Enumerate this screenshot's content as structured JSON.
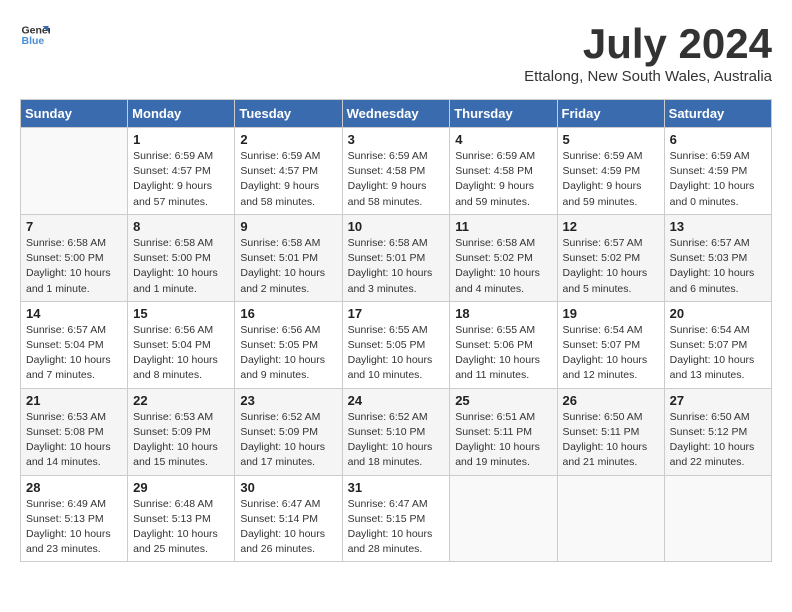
{
  "header": {
    "logo_general": "General",
    "logo_blue": "Blue",
    "month": "July 2024",
    "subtitle": "Ettalong, New South Wales, Australia"
  },
  "calendar": {
    "days_of_week": [
      "Sunday",
      "Monday",
      "Tuesday",
      "Wednesday",
      "Thursday",
      "Friday",
      "Saturday"
    ],
    "weeks": [
      [
        {
          "day": "",
          "info": ""
        },
        {
          "day": "1",
          "info": "Sunrise: 6:59 AM\nSunset: 4:57 PM\nDaylight: 9 hours\nand 57 minutes."
        },
        {
          "day": "2",
          "info": "Sunrise: 6:59 AM\nSunset: 4:57 PM\nDaylight: 9 hours\nand 58 minutes."
        },
        {
          "day": "3",
          "info": "Sunrise: 6:59 AM\nSunset: 4:58 PM\nDaylight: 9 hours\nand 58 minutes."
        },
        {
          "day": "4",
          "info": "Sunrise: 6:59 AM\nSunset: 4:58 PM\nDaylight: 9 hours\nand 59 minutes."
        },
        {
          "day": "5",
          "info": "Sunrise: 6:59 AM\nSunset: 4:59 PM\nDaylight: 9 hours\nand 59 minutes."
        },
        {
          "day": "6",
          "info": "Sunrise: 6:59 AM\nSunset: 4:59 PM\nDaylight: 10 hours\nand 0 minutes."
        }
      ],
      [
        {
          "day": "7",
          "info": "Sunrise: 6:58 AM\nSunset: 5:00 PM\nDaylight: 10 hours\nand 1 minute."
        },
        {
          "day": "8",
          "info": "Sunrise: 6:58 AM\nSunset: 5:00 PM\nDaylight: 10 hours\nand 1 minute."
        },
        {
          "day": "9",
          "info": "Sunrise: 6:58 AM\nSunset: 5:01 PM\nDaylight: 10 hours\nand 2 minutes."
        },
        {
          "day": "10",
          "info": "Sunrise: 6:58 AM\nSunset: 5:01 PM\nDaylight: 10 hours\nand 3 minutes."
        },
        {
          "day": "11",
          "info": "Sunrise: 6:58 AM\nSunset: 5:02 PM\nDaylight: 10 hours\nand 4 minutes."
        },
        {
          "day": "12",
          "info": "Sunrise: 6:57 AM\nSunset: 5:02 PM\nDaylight: 10 hours\nand 5 minutes."
        },
        {
          "day": "13",
          "info": "Sunrise: 6:57 AM\nSunset: 5:03 PM\nDaylight: 10 hours\nand 6 minutes."
        }
      ],
      [
        {
          "day": "14",
          "info": "Sunrise: 6:57 AM\nSunset: 5:04 PM\nDaylight: 10 hours\nand 7 minutes."
        },
        {
          "day": "15",
          "info": "Sunrise: 6:56 AM\nSunset: 5:04 PM\nDaylight: 10 hours\nand 8 minutes."
        },
        {
          "day": "16",
          "info": "Sunrise: 6:56 AM\nSunset: 5:05 PM\nDaylight: 10 hours\nand 9 minutes."
        },
        {
          "day": "17",
          "info": "Sunrise: 6:55 AM\nSunset: 5:05 PM\nDaylight: 10 hours\nand 10 minutes."
        },
        {
          "day": "18",
          "info": "Sunrise: 6:55 AM\nSunset: 5:06 PM\nDaylight: 10 hours\nand 11 minutes."
        },
        {
          "day": "19",
          "info": "Sunrise: 6:54 AM\nSunset: 5:07 PM\nDaylight: 10 hours\nand 12 minutes."
        },
        {
          "day": "20",
          "info": "Sunrise: 6:54 AM\nSunset: 5:07 PM\nDaylight: 10 hours\nand 13 minutes."
        }
      ],
      [
        {
          "day": "21",
          "info": "Sunrise: 6:53 AM\nSunset: 5:08 PM\nDaylight: 10 hours\nand 14 minutes."
        },
        {
          "day": "22",
          "info": "Sunrise: 6:53 AM\nSunset: 5:09 PM\nDaylight: 10 hours\nand 15 minutes."
        },
        {
          "day": "23",
          "info": "Sunrise: 6:52 AM\nSunset: 5:09 PM\nDaylight: 10 hours\nand 17 minutes."
        },
        {
          "day": "24",
          "info": "Sunrise: 6:52 AM\nSunset: 5:10 PM\nDaylight: 10 hours\nand 18 minutes."
        },
        {
          "day": "25",
          "info": "Sunrise: 6:51 AM\nSunset: 5:11 PM\nDaylight: 10 hours\nand 19 minutes."
        },
        {
          "day": "26",
          "info": "Sunrise: 6:50 AM\nSunset: 5:11 PM\nDaylight: 10 hours\nand 21 minutes."
        },
        {
          "day": "27",
          "info": "Sunrise: 6:50 AM\nSunset: 5:12 PM\nDaylight: 10 hours\nand 22 minutes."
        }
      ],
      [
        {
          "day": "28",
          "info": "Sunrise: 6:49 AM\nSunset: 5:13 PM\nDaylight: 10 hours\nand 23 minutes."
        },
        {
          "day": "29",
          "info": "Sunrise: 6:48 AM\nSunset: 5:13 PM\nDaylight: 10 hours\nand 25 minutes."
        },
        {
          "day": "30",
          "info": "Sunrise: 6:47 AM\nSunset: 5:14 PM\nDaylight: 10 hours\nand 26 minutes."
        },
        {
          "day": "31",
          "info": "Sunrise: 6:47 AM\nSunset: 5:15 PM\nDaylight: 10 hours\nand 28 minutes."
        },
        {
          "day": "",
          "info": ""
        },
        {
          "day": "",
          "info": ""
        },
        {
          "day": "",
          "info": ""
        }
      ]
    ]
  }
}
